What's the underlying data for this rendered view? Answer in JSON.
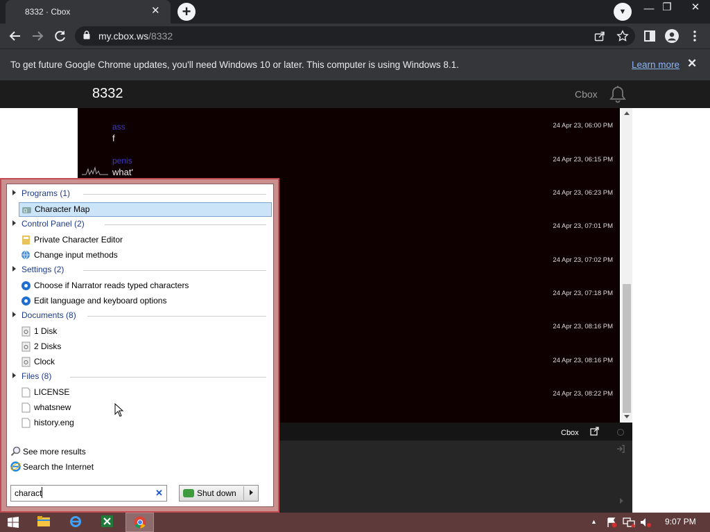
{
  "browser": {
    "tab_title": "8332 · Cbox",
    "tab_close": "✕",
    "new_tab": "+",
    "tab_search": "▼",
    "window_minimize": "—",
    "window_restore": "❐",
    "window_close": "✕",
    "url_host": "my.cbox.ws",
    "url_path": "/8332",
    "infobar_text": "To get future Google Chrome updates, you'll need Windows 10 or later. This computer is using Windows 8.1.",
    "infobar_link": "Learn more",
    "infobar_close": "✕"
  },
  "cbox": {
    "room_title": "8332",
    "brand": "Cbox",
    "messages": [
      {
        "name": "ass",
        "text": "f",
        "time": "24 Apr 23, 06:00 PM"
      },
      {
        "name": "penis",
        "text": "what'",
        "time": "24 Apr 23, 06:15 PM"
      },
      {
        "name": "",
        "text": "",
        "time": "24 Apr 23, 06:23 PM"
      },
      {
        "name": "",
        "text": "",
        "time": "24 Apr 23, 07:01 PM"
      },
      {
        "name": "",
        "text": "",
        "time": "24 Apr 23, 07:02 PM"
      },
      {
        "name": "",
        "text": "",
        "time": "24 Apr 23, 07:18 PM"
      },
      {
        "name": "",
        "text": "",
        "time": "24 Apr 23, 08:16 PM"
      },
      {
        "name": "",
        "text": "",
        "time": "24 Apr 23, 08:16 PM"
      },
      {
        "name": "",
        "text": "",
        "time": "24 Apr 23, 08:22 PM"
      }
    ],
    "footer_brand": "Cbox"
  },
  "start_menu": {
    "groups": [
      {
        "label": "Programs (1)",
        "items": [
          {
            "label": "Character Map",
            "icon": "charmap-icon",
            "selected": true
          }
        ]
      },
      {
        "label": "Control Panel (2)",
        "items": [
          {
            "label": "Private Character Editor",
            "icon": "char-editor-icon"
          },
          {
            "label": "Change input methods",
            "icon": "globe-keyboard-icon"
          }
        ]
      },
      {
        "label": "Settings (2)",
        "items": [
          {
            "label": "Choose if Narrator reads typed characters",
            "icon": "gear-icon"
          },
          {
            "label": "Edit language and keyboard options",
            "icon": "gear-icon"
          }
        ]
      },
      {
        "label": "Documents (8)",
        "items": [
          {
            "label": "1 Disk",
            "icon": "settings-file-icon"
          },
          {
            "label": "2 Disks",
            "icon": "settings-file-icon"
          },
          {
            "label": "Clock",
            "icon": "settings-file-icon"
          }
        ]
      },
      {
        "label": "Files (8)",
        "items": [
          {
            "label": "LICENSE",
            "icon": "document-icon"
          },
          {
            "label": "whatsnew",
            "icon": "document-icon"
          },
          {
            "label": "history.eng",
            "icon": "document-icon"
          }
        ]
      }
    ],
    "see_more": "See more results",
    "search_internet": "Search the Internet",
    "search_value": "charact",
    "search_clear": "✕",
    "shutdown_label": "Shut down"
  },
  "taskbar": {
    "apps": [
      "windows-start-icon",
      "file-explorer-icon",
      "internet-explorer-icon",
      "excel-icon",
      "chrome-icon"
    ],
    "clock": "9:07 PM",
    "tray_up": "▲"
  },
  "colors": {
    "chrome_dark": "#202124",
    "chrome_toolbar": "#35363a",
    "chat_bg": "#0e0000",
    "start_frame": "#c9908f",
    "taskbar": "#5e3a3b"
  }
}
